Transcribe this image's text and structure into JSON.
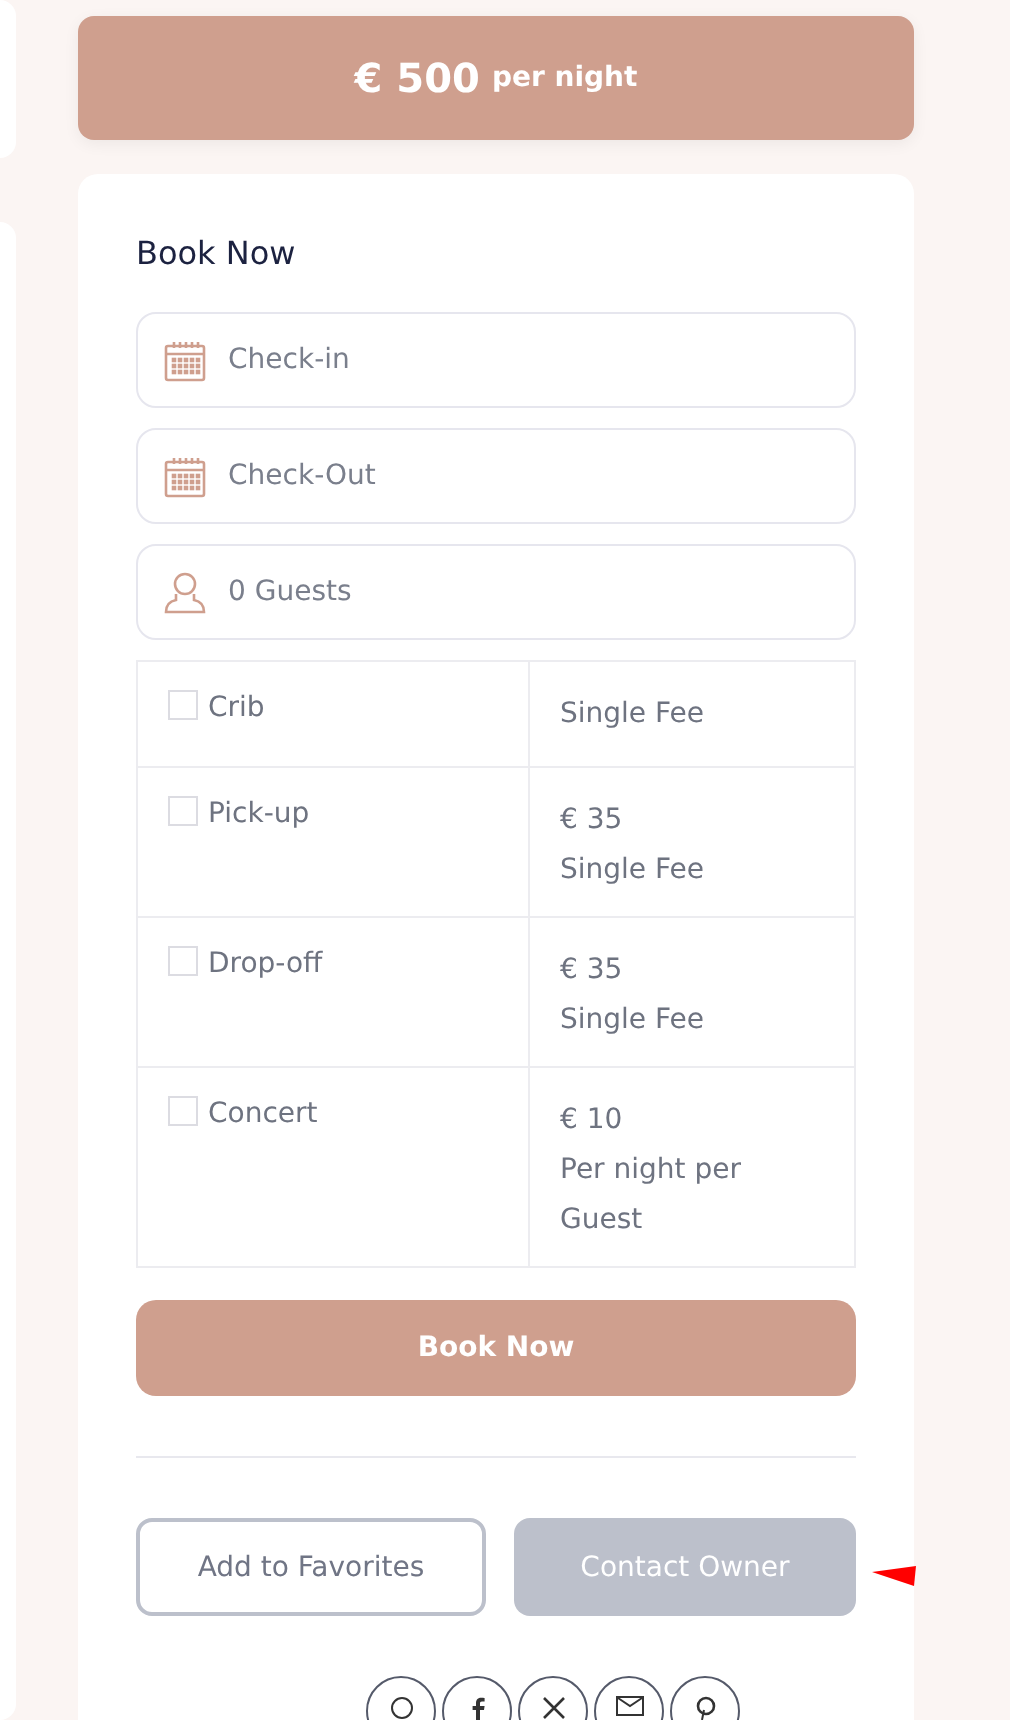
{
  "price": {
    "amount": "€ 500",
    "unit": "per night"
  },
  "booking": {
    "title": "Book Now",
    "fields": [
      {
        "kind": "date",
        "placeholder": "Check-in"
      },
      {
        "kind": "date",
        "placeholder": "Check-Out"
      },
      {
        "kind": "guests",
        "placeholder": "0 Guests"
      }
    ],
    "extras": [
      {
        "name": "Crib",
        "checked": false,
        "fee": "Single Fee"
      },
      {
        "name": "Pick-up",
        "checked": false,
        "price": "€ 35",
        "fee": "Single Fee"
      },
      {
        "name": "Drop-off",
        "checked": false,
        "price": "€ 35",
        "fee": "Single Fee"
      },
      {
        "name": "Concert",
        "checked": false,
        "price": "€ 10",
        "fee": "Per night per Guest"
      }
    ],
    "submit": "Book Now",
    "favorites": "Add to Favorites",
    "contact": "Contact Owner",
    "share_buttons": [
      {
        "kind": "chat"
      },
      {
        "kind": "facebook"
      },
      {
        "kind": "x"
      },
      {
        "kind": "email"
      },
      {
        "kind": "pin"
      }
    ]
  }
}
